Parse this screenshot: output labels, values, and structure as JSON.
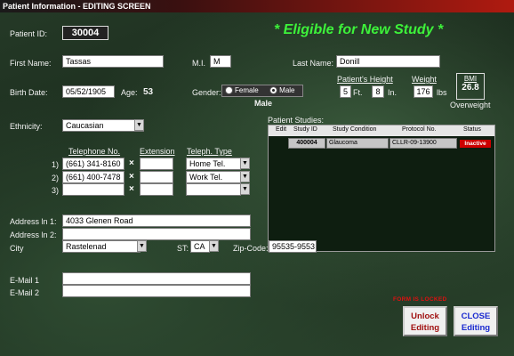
{
  "window": {
    "title": "Patient Information - EDITING SCREEN"
  },
  "patient": {
    "id_label": "Patient ID:",
    "id_value": "30004",
    "eligibility": "* Eligible for New Study *",
    "first_name_label": "First Name:",
    "first_name": "Tassas",
    "mi_label": "M.I.",
    "mi": "M",
    "last_name_label": "Last Name:",
    "last_name": "Donill",
    "birth_date_label": "Birth Date:",
    "birth_date": "05/52/1905",
    "age_label": "Age:",
    "age": "53",
    "gender_label": "Gender:",
    "gender_female": "Female",
    "gender_male": "Male",
    "gender_value": "Male",
    "height_label": "Patient's Height",
    "height_ft": "5",
    "ft_label": "Ft.",
    "height_in": "8",
    "in_label": "In.",
    "weight_label": "Weight",
    "weight": "176",
    "lbs_label": "lbs",
    "bmi_label": "BMI",
    "bmi_value": "26.8",
    "bmi_status": "Overweight",
    "ethnicity_label": "Ethnicity:",
    "ethnicity": "Caucasian"
  },
  "phones": {
    "col_phone": "Telephone No.",
    "col_ext": "Extension",
    "col_type": "Teleph. Type",
    "rows": [
      {
        "n": "1)",
        "number": "(661) 341-8160",
        "ext": "",
        "type": "Home Tel."
      },
      {
        "n": "2)",
        "number": "(661) 400-7478",
        "ext": "",
        "type": "Work Tel."
      },
      {
        "n": "3)",
        "number": "",
        "ext": "",
        "type": ""
      }
    ],
    "times": "×"
  },
  "address": {
    "line1_label": "Address ln 1:",
    "line1": "4033 Glenen Road",
    "line2_label": "Address ln 2:",
    "line2": "",
    "city_label": "City",
    "city": "Rastelenad",
    "st_label": "ST:",
    "st": "CA",
    "zip_label": "Zip-Code:",
    "zip": "95535-9553"
  },
  "email": {
    "email1_label": "E-Mail 1",
    "email1": "",
    "email2_label": "E-Mail 2",
    "email2": ""
  },
  "studies": {
    "title": "Patient Studies:",
    "headers": [
      "Edit",
      "Study ID",
      "Study Condition",
      "Protocol No.",
      "Status"
    ],
    "rows": [
      {
        "study_id": "400004",
        "condition": "Glaucoma",
        "protocol": "CLLR-09-13900",
        "status": "Inactive"
      }
    ]
  },
  "footer": {
    "locked_text": "FORM IS LOCKED",
    "unlock_line1": "Unlock",
    "unlock_line2": "Editing",
    "close_line1": "CLOSE",
    "close_line2": "Editing"
  },
  "colors": {
    "eligible": "#3df23a",
    "unlock_text": "#a01010",
    "close_text": "#1a2ad0",
    "inactive_bg": "#cc0000"
  }
}
